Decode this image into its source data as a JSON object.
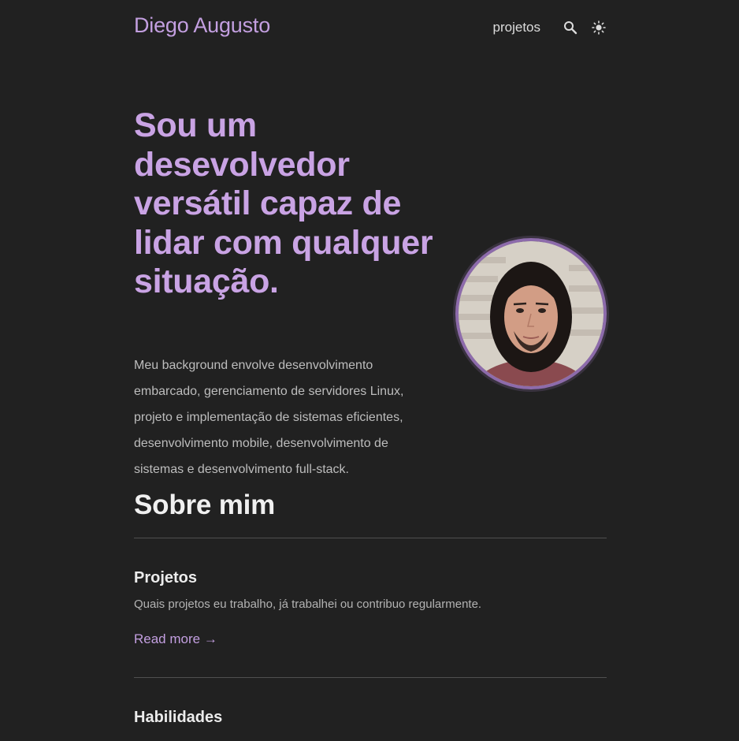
{
  "header": {
    "site_title": "Diego Augusto",
    "nav": [
      {
        "label": "projetos"
      }
    ],
    "icons": [
      "search-icon",
      "sun-icon"
    ]
  },
  "hero": {
    "title": "Sou um desevolvedor versátil capaz de lidar com qualquer situação.",
    "text": "Meu background envolve desenvolvimento embarcado, gerenciamento de servidores Linux, projeto e implementação de sistemas eficientes, desenvolvimento mobile, desenvolvimento de sistemas e desenvolvimento full-stack."
  },
  "about": {
    "title": "Sobre mim",
    "cards": [
      {
        "title": "Projetos",
        "description": "Quais projetos eu trabalho, já trabalhei ou contribuo regularmente.",
        "link": "Read more →"
      },
      {
        "title": "Habilidades"
      }
    ]
  },
  "colors": {
    "background": "#212121",
    "accent": "#c39fe0",
    "text": "#e6e6e6",
    "muted": "#bdbdbd"
  }
}
